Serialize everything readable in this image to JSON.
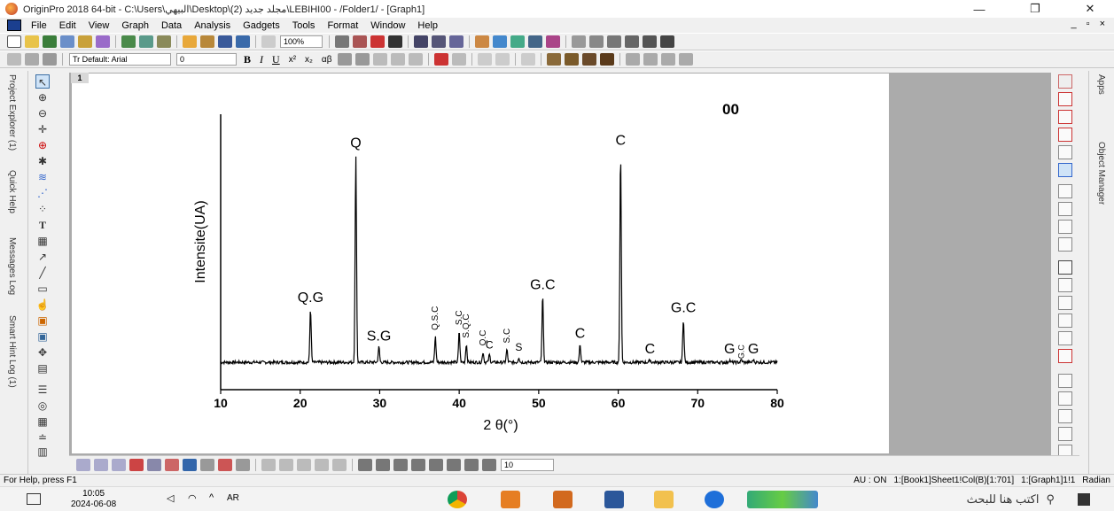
{
  "window": {
    "title": "OriginPro 2018 64-bit - C:\\Users\\البيهي\\Desktop\\(2) مجلد جديد\\LEBIHI00 - /Folder1/ - [Graph1]",
    "minimize": "—",
    "restore": "❐",
    "close": "✕"
  },
  "menu": [
    "File",
    "Edit",
    "View",
    "Graph",
    "Data",
    "Analysis",
    "Gadgets",
    "Tools",
    "Format",
    "Window",
    "Help"
  ],
  "mdi_controls": "_ ▫ ×",
  "toolbar": {
    "zoom": "100%",
    "font": "Tr Default: Arial",
    "font_size": "0",
    "bold": "B",
    "italic": "I",
    "underline": "U",
    "superscript": "x²",
    "subscript": "x₂",
    "alpha_beta": "αβ",
    "line_width": "10"
  },
  "left_dock_tabs": [
    "Project Explorer (1)",
    "Quick Help",
    "Messages Log",
    "Smart Hint Log (1)"
  ],
  "right_dock_tabs": [
    "Apps",
    "Object Manager"
  ],
  "layer_number": "1",
  "status": {
    "left": "For Help, press F1",
    "au": "AU : ON",
    "book": "1:[Book1]Sheet1!Col(B)[1:701]",
    "graph": "1:[Graph1]1!1",
    "unit": "Radian"
  },
  "taskbar": {
    "time": "10:05",
    "date": "2024-06-08",
    "lang": "AR",
    "search_placeholder": "اكتب هنا للبحث"
  },
  "colors": {
    "accent": "#0078d7",
    "canvas_bg": "#ababab"
  },
  "chart_data": {
    "type": "line",
    "title": "00",
    "xlabel": "2 θ(°)",
    "ylabel": "Intensite(UA)",
    "xlim": [
      10,
      80
    ],
    "xticks": [
      "10",
      "20",
      "30",
      "40",
      "50",
      "60",
      "70",
      "80"
    ],
    "peaks": [
      {
        "x": 21.3,
        "y": 0.21,
        "label": "Q.G"
      },
      {
        "x": 27.0,
        "y": 0.81,
        "label": "Q"
      },
      {
        "x": 29.9,
        "y": 0.06,
        "label": "S.G"
      },
      {
        "x": 37.0,
        "y": 0.1,
        "label": "Q.S.C"
      },
      {
        "x": 40.0,
        "y": 0.12,
        "label": "S.C"
      },
      {
        "x": 40.9,
        "y": 0.07,
        "label": "S.Q.C"
      },
      {
        "x": 43.0,
        "y": 0.04,
        "label": "Q.C"
      },
      {
        "x": 43.8,
        "y": 0.03,
        "label": "C"
      },
      {
        "x": 46.0,
        "y": 0.05,
        "label": "S.C"
      },
      {
        "x": 47.5,
        "y": 0.02,
        "label": "S"
      },
      {
        "x": 50.5,
        "y": 0.26,
        "label": "G.C"
      },
      {
        "x": 55.2,
        "y": 0.07,
        "label": "C"
      },
      {
        "x": 60.3,
        "y": 0.82,
        "label": "C"
      },
      {
        "x": 64.0,
        "y": 0.01,
        "label": "C"
      },
      {
        "x": 68.2,
        "y": 0.17,
        "label": "G.C"
      },
      {
        "x": 74.0,
        "y": 0.01,
        "label": "G"
      },
      {
        "x": 75.5,
        "y": 0.01,
        "label": "G.C"
      },
      {
        "x": 77.0,
        "y": 0.01,
        "label": "G"
      }
    ]
  }
}
